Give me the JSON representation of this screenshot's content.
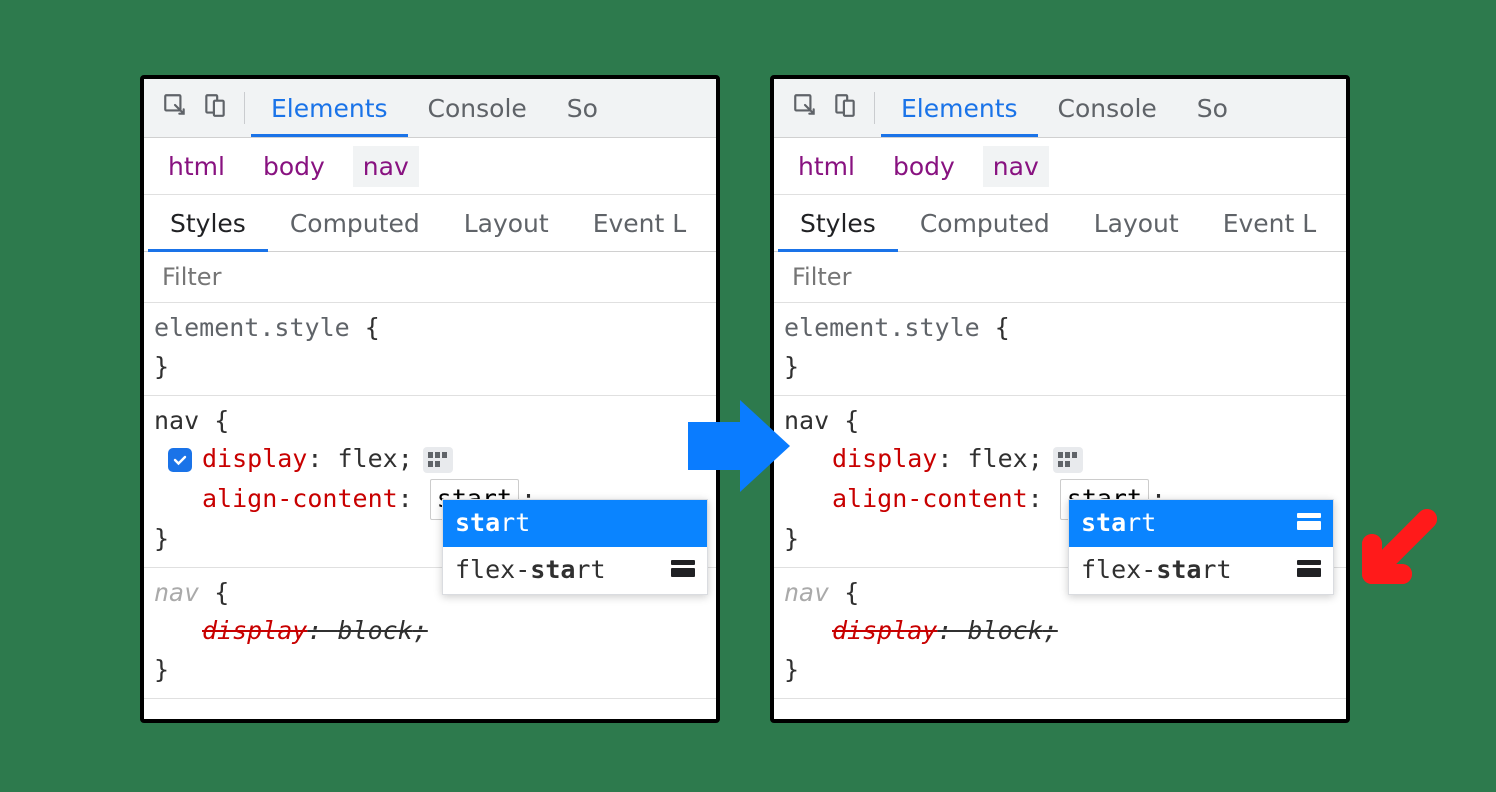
{
  "top_tabs": {
    "elements": "Elements",
    "console": "Console",
    "sources_prefix": "So"
  },
  "breadcrumb": {
    "html": "html",
    "body": "body",
    "nav": "nav"
  },
  "sub_tabs": {
    "styles": "Styles",
    "computed": "Computed",
    "layout": "Layout",
    "event_prefix": "Event L"
  },
  "filter_placeholder": "Filter",
  "element_style_label": "element.style",
  "nav_rule": {
    "selector": "nav",
    "display": {
      "name": "display",
      "value": "flex"
    },
    "align_content": {
      "name": "align-content",
      "value": "start"
    }
  },
  "overridden_rule": {
    "selector": "nav",
    "display": {
      "name": "display",
      "value": "block"
    }
  },
  "autocomplete": {
    "option1_bold": "sta",
    "option1_rest": "rt",
    "option2_prefix": "flex-",
    "option2_bold": "sta",
    "option2_rest": "rt"
  },
  "colors": {
    "accent": "#1a73e8",
    "prop_name": "#c80000",
    "crumb": "#881280",
    "highlight": "#0a84ff",
    "red": "#ff1a1a"
  }
}
